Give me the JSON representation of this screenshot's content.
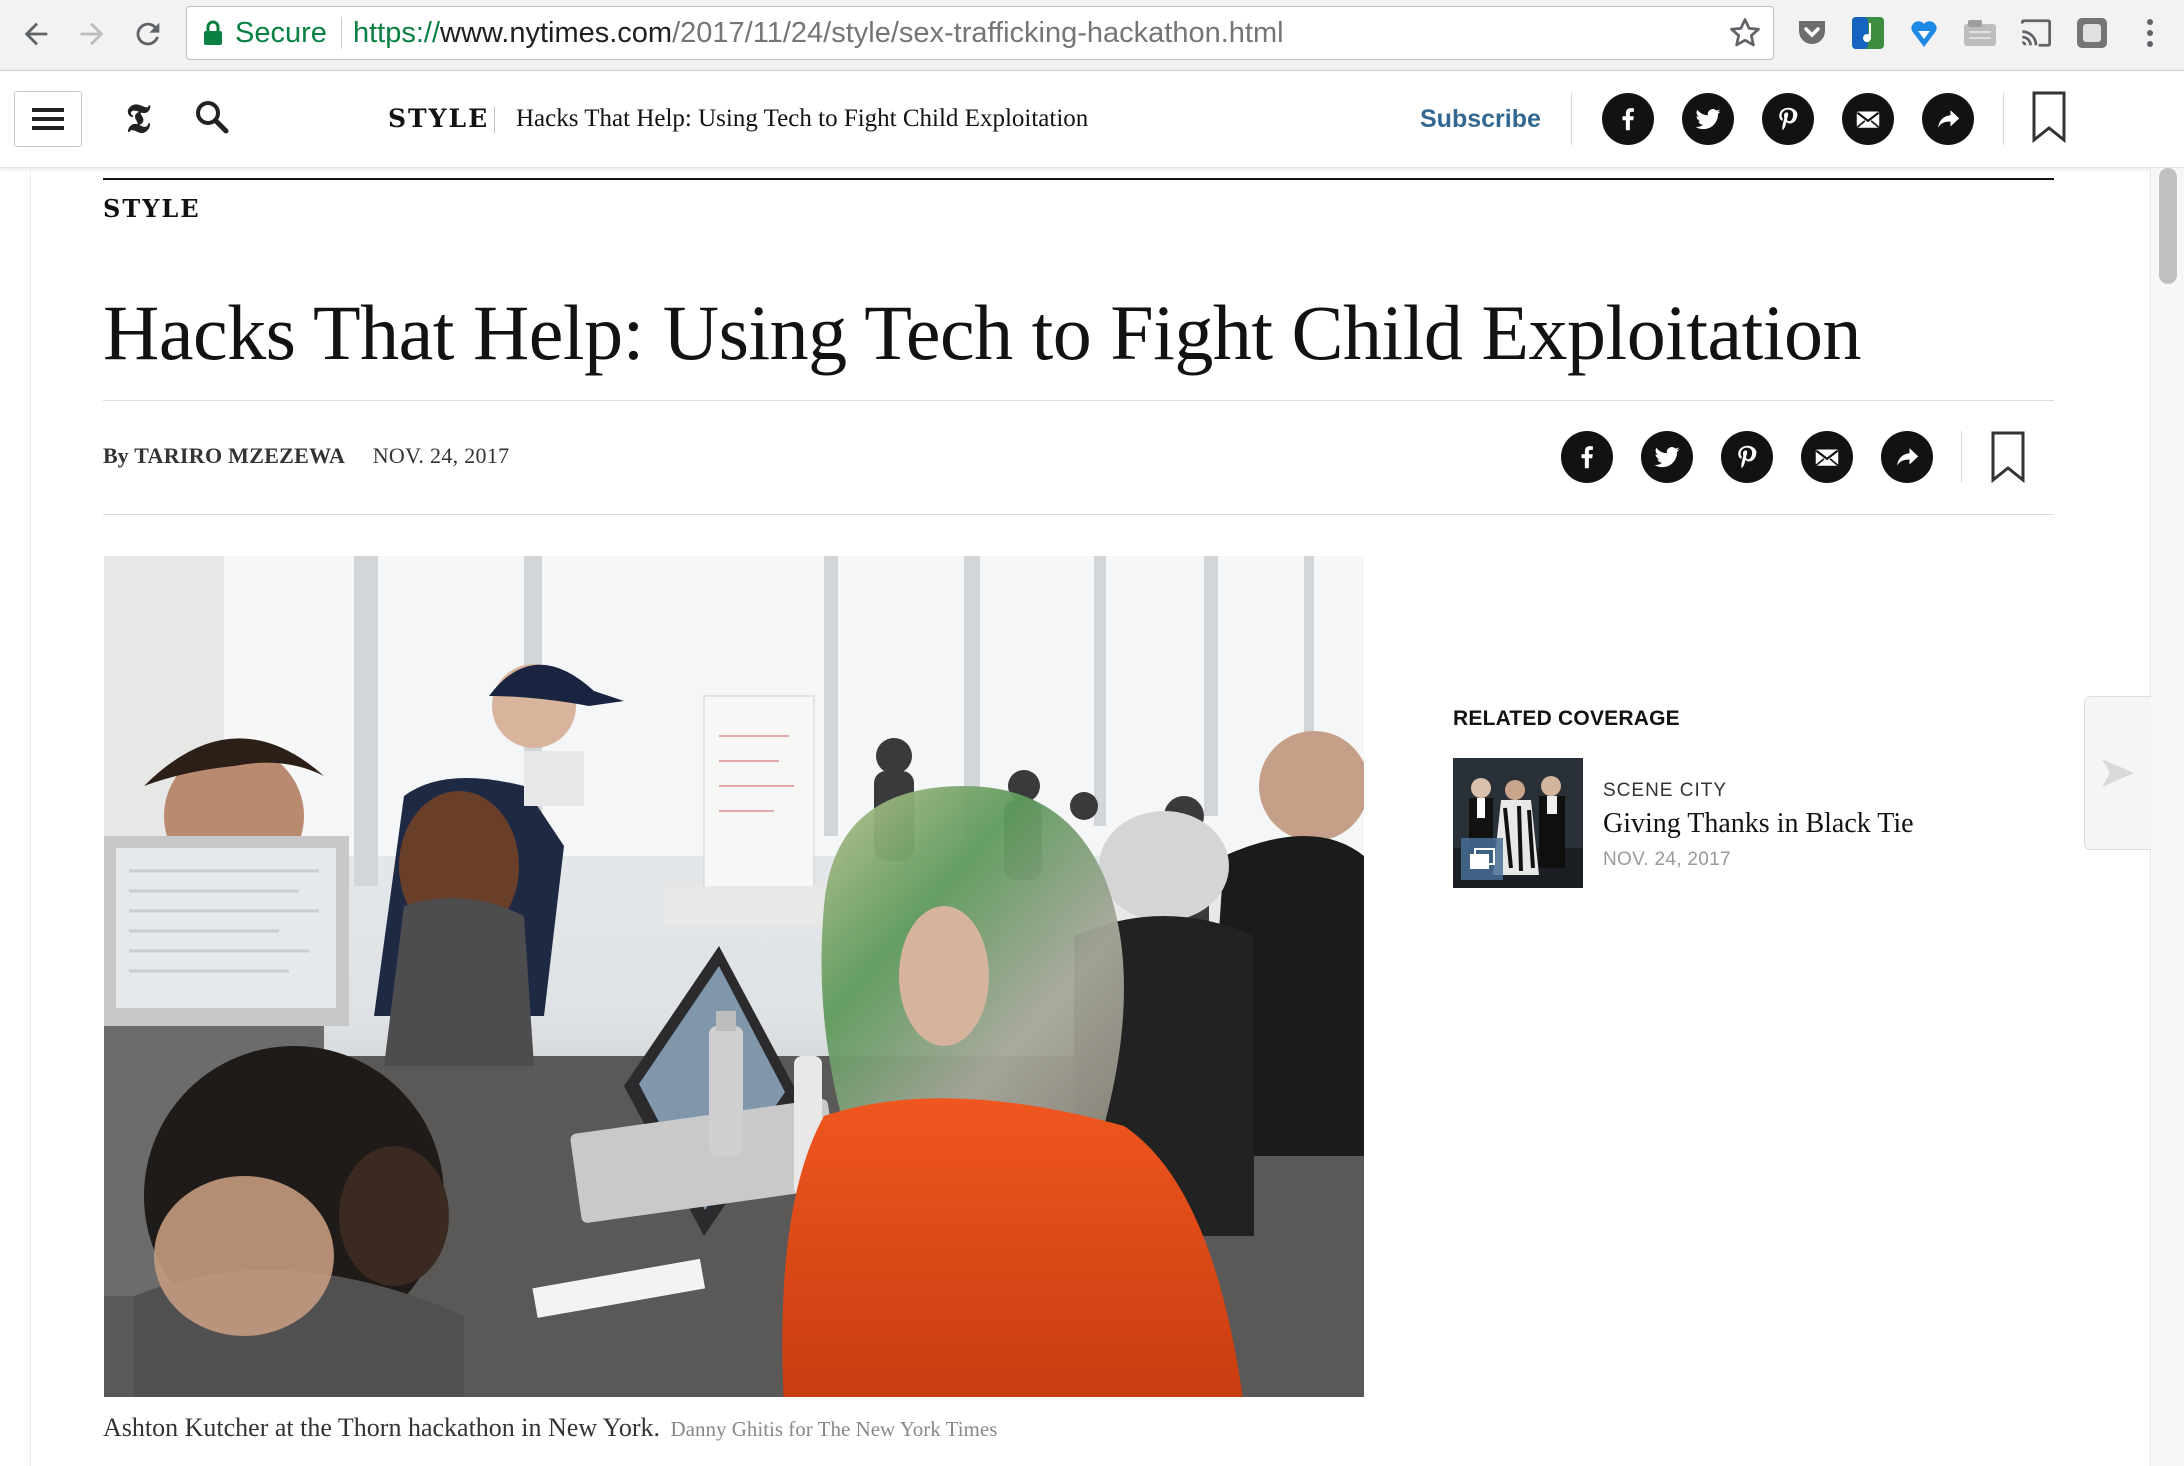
{
  "browser": {
    "secure_label": "Secure",
    "url_protocol": "https://",
    "url_host": "www.nytimes.com",
    "url_path": "/2017/11/24/style/sex-trafficking-hackathon.html"
  },
  "header": {
    "section_label": "STYLE",
    "headline": "Hacks That Help: Using Tech to Fight Child Exploitation",
    "subscribe_label": "Subscribe"
  },
  "article": {
    "kicker": "STYLE",
    "headline": "Hacks That Help: Using Tech to Fight Child Exploitation",
    "byline_prefix": "By",
    "author": "TARIRO MZEZEWA",
    "date": "NOV. 24, 2017",
    "caption": "Ashton Kutcher at the Thorn hackathon in New York.",
    "credit": "Danny Ghitis for The New York Times"
  },
  "related": {
    "title": "RELATED COVERAGE",
    "items": [
      {
        "kicker": "SCENE CITY",
        "headline": "Giving Thanks in Black Tie",
        "date": "NOV. 24, 2017"
      }
    ]
  },
  "colors": {
    "brand_link": "#326891",
    "secure_green": "#0b8043",
    "text": "#121212"
  },
  "icons": [
    "back-icon",
    "forward-icon",
    "reload-icon",
    "lock-icon",
    "star-icon",
    "menu-icon",
    "nyt-t-logo",
    "search-icon",
    "facebook-icon",
    "twitter-icon",
    "pinterest-icon",
    "email-icon",
    "share-icon",
    "bookmark-icon",
    "next-arrow-icon",
    "gallery-icon"
  ]
}
